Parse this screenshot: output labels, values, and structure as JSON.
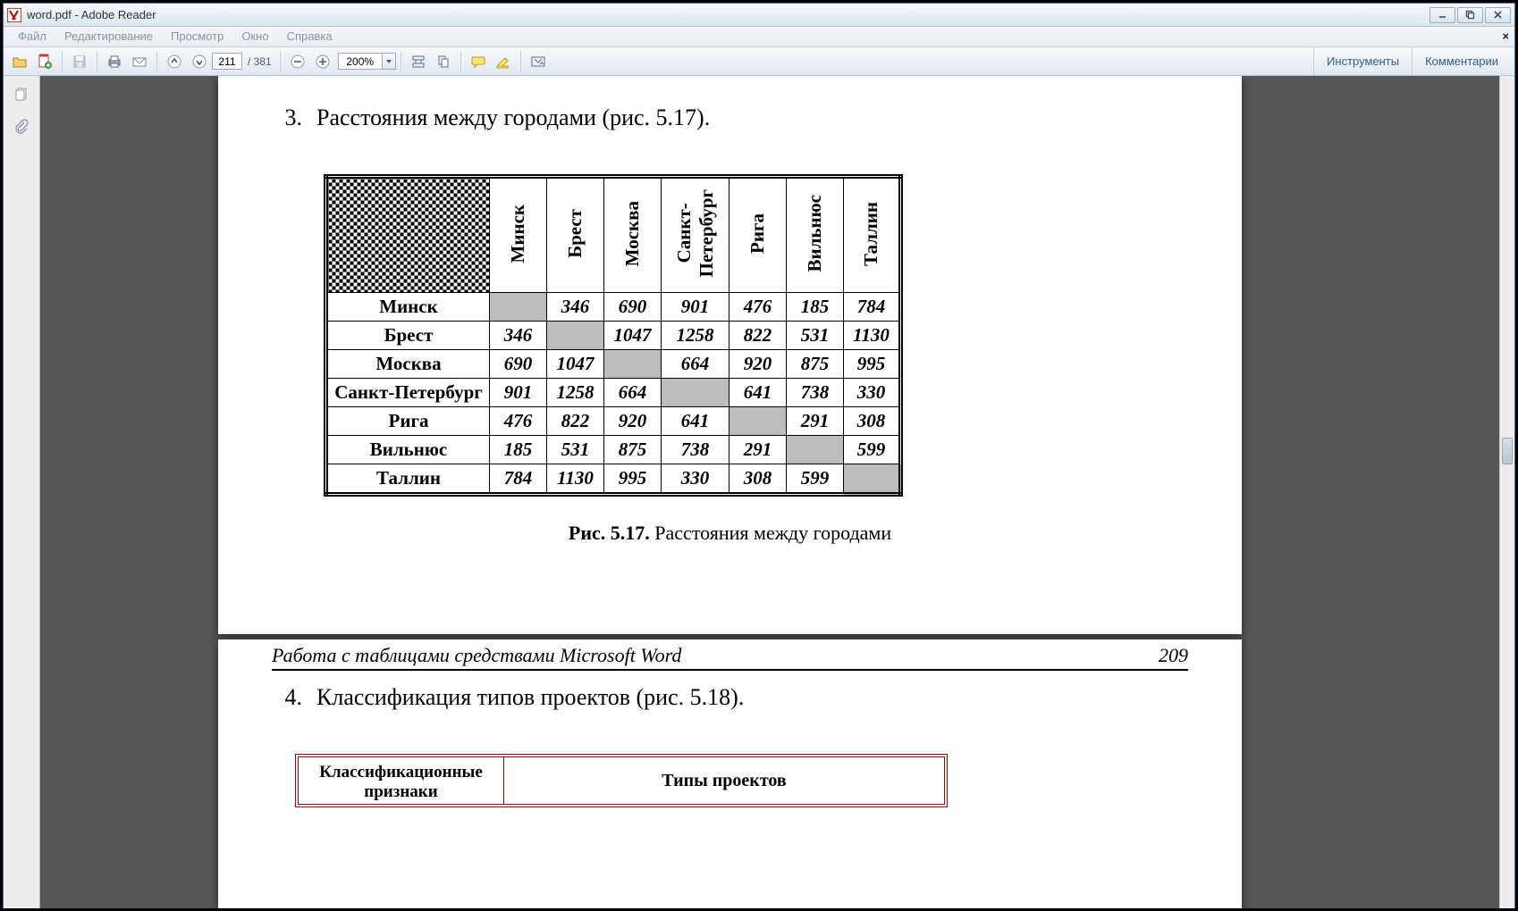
{
  "window": {
    "title": "word.pdf - Adobe Reader"
  },
  "menu": {
    "file": "Файл",
    "edit": "Редактирование",
    "view": "Просмотр",
    "window": "Окно",
    "help": "Справка"
  },
  "toolbar": {
    "page_current": "211",
    "page_total": "/ 381",
    "zoom": "200%",
    "right_tools": "Инструменты",
    "right_comments": "Комментарии"
  },
  "doc": {
    "item3_no": "3.",
    "item3_text": "Расстояния между городами (рис. 5.17).",
    "cities": [
      "Минск",
      "Брест",
      "Москва",
      "Санкт-Петербург",
      "Рига",
      "Вильнюс",
      "Таллин"
    ],
    "city_header_sp": "Санкт-\nПетербург",
    "dist": [
      [
        "",
        "346",
        "690",
        "901",
        "476",
        "185",
        "784"
      ],
      [
        "346",
        "",
        "1047",
        "1258",
        "822",
        "531",
        "1130"
      ],
      [
        "690",
        "1047",
        "",
        "664",
        "920",
        "875",
        "995"
      ],
      [
        "901",
        "1258",
        "664",
        "",
        "641",
        "738",
        "330"
      ],
      [
        "476",
        "822",
        "920",
        "641",
        "",
        "291",
        "308"
      ],
      [
        "185",
        "531",
        "875",
        "738",
        "291",
        "",
        "599"
      ],
      [
        "784",
        "1130",
        "995",
        "330",
        "308",
        "599",
        ""
      ]
    ],
    "caption_b": "Рис. 5.17.",
    "caption_t": " Расстояния между городами",
    "footer_left": "Работа с таблицами средствами Microsoft Word",
    "footer_right": "209",
    "item4_no": "4.",
    "item4_text": "Классификация типов проектов (рис. 5.18).",
    "redcol1": "Классификационные признаки",
    "redcol2": "Типы проектов"
  }
}
